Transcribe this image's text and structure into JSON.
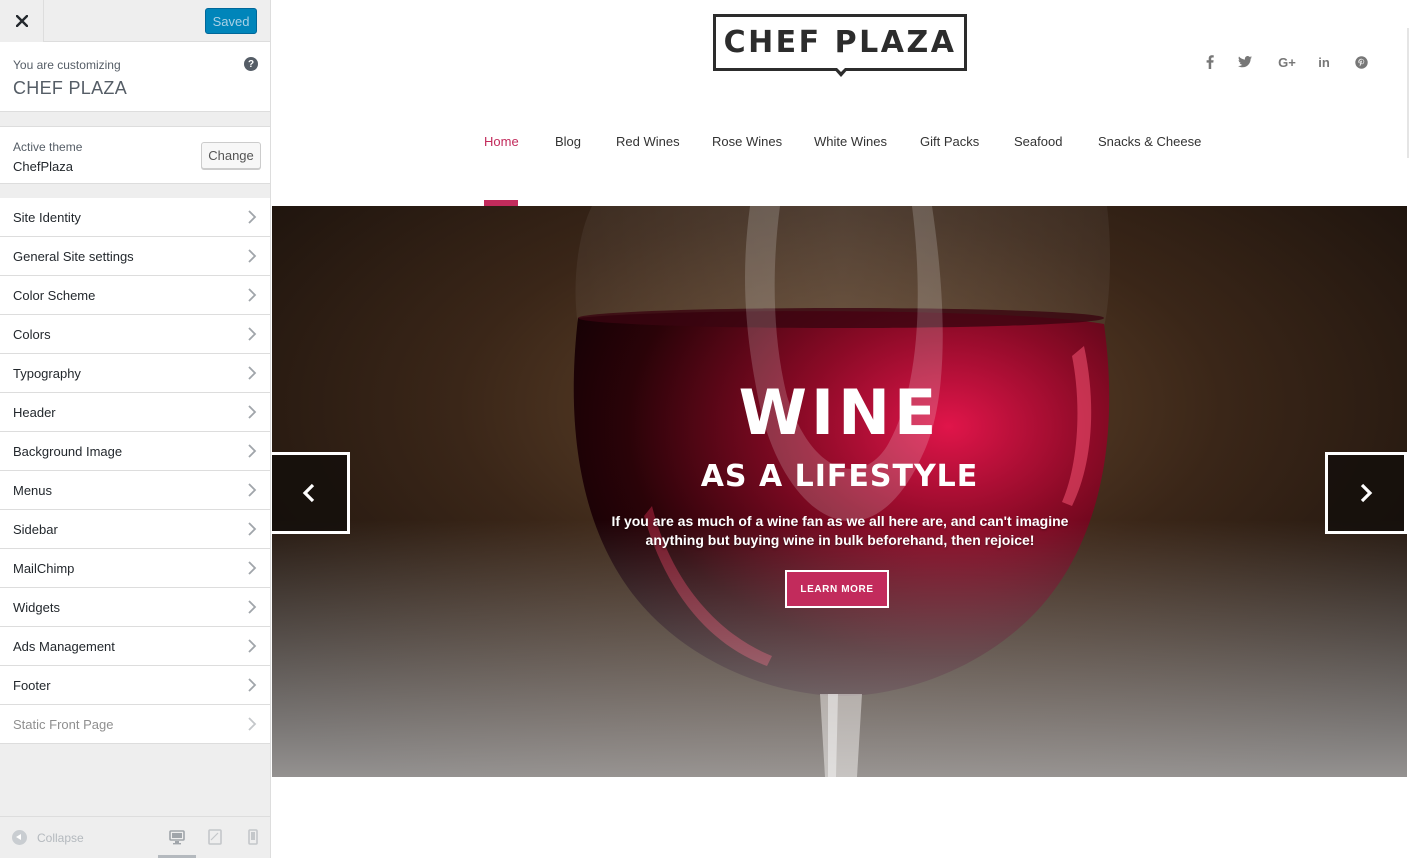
{
  "window": {
    "title": "CHEF PLAZA"
  },
  "sidebar": {
    "saved_label": "Saved",
    "customizing_caption": "You are customizing",
    "site_title": "CHEF PLAZA",
    "help_symbol": "?",
    "active_theme_caption": "Active theme",
    "active_theme_name": "ChefPlaza",
    "change_label": "Change",
    "panels": [
      {
        "label": "Site Identity"
      },
      {
        "label": "General Site settings"
      },
      {
        "label": "Color Scheme"
      },
      {
        "label": "Colors"
      },
      {
        "label": "Typography"
      },
      {
        "label": "Header"
      },
      {
        "label": "Background Image"
      },
      {
        "label": "Menus"
      },
      {
        "label": "Sidebar"
      },
      {
        "label": "MailChimp"
      },
      {
        "label": "Widgets"
      },
      {
        "label": "Ads Management"
      },
      {
        "label": "Footer"
      },
      {
        "label": "Static Front Page"
      }
    ],
    "collapse_label": "Collapse",
    "devices": [
      "desktop-icon",
      "tablet-icon",
      "mobile-icon"
    ]
  },
  "preview": {
    "logo": "CHEF PLAZA",
    "social": [
      {
        "name": "facebook-icon",
        "glyph": "f"
      },
      {
        "name": "twitter-icon",
        "glyph": "🐦"
      },
      {
        "name": "google-plus-icon",
        "glyph": "G+"
      },
      {
        "name": "linkedin-icon",
        "glyph": "in"
      },
      {
        "name": "pinterest-icon",
        "glyph": "P"
      }
    ],
    "nav": [
      {
        "label": "Home",
        "active": true
      },
      {
        "label": "Blog",
        "active": false
      },
      {
        "label": "Red Wines",
        "active": false
      },
      {
        "label": "Rose Wines",
        "active": false
      },
      {
        "label": "White Wines",
        "active": false
      },
      {
        "label": "Gift Packs",
        "active": false
      },
      {
        "label": "Seafood",
        "active": false
      },
      {
        "label": "Snacks & Cheese",
        "active": false
      }
    ],
    "hero": {
      "title": "WINE",
      "subtitle": "AS A LIFESTYLE",
      "text": "If you are as much of a wine fan as we all here are, and can't imagine anything but buying wine in bulk beforehand, then rejoice!",
      "button": "LEARN MORE"
    }
  },
  "colors": {
    "accent": "#c22b5c",
    "wp_blue": "#0085ba",
    "text_dark": "#23282d",
    "logo": "#2c2c2c"
  }
}
